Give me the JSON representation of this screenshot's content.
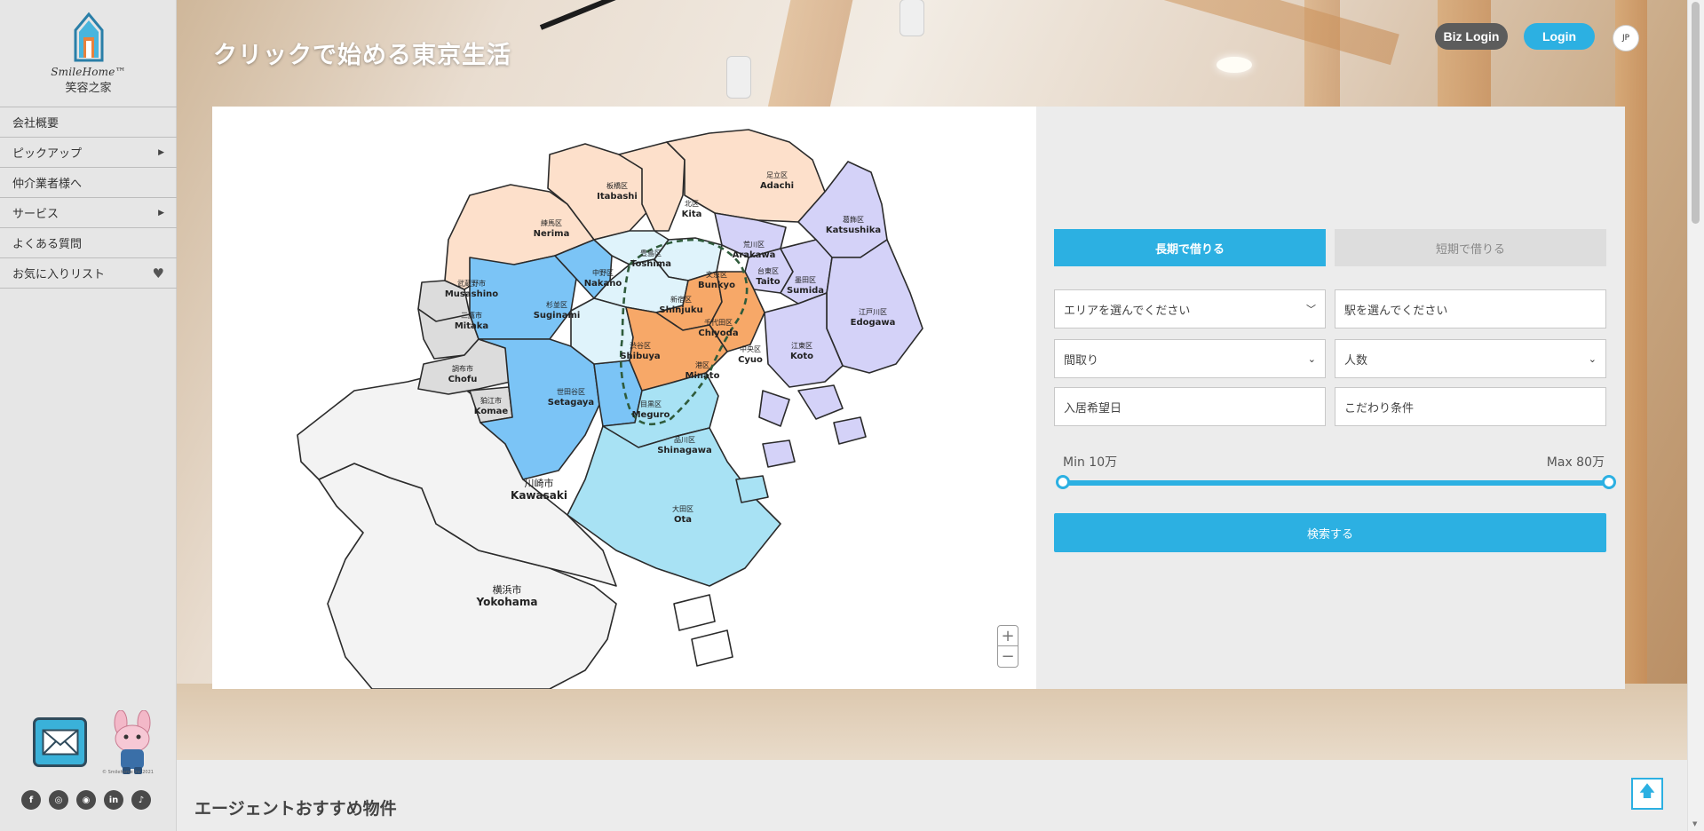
{
  "brand": {
    "name": "SmileHome™",
    "sub": "笑容之家"
  },
  "nav": [
    {
      "label": "会社概要",
      "has_submenu": false
    },
    {
      "label": "ピックアップ",
      "has_submenu": true
    },
    {
      "label": "仲介業者様へ",
      "has_submenu": false
    },
    {
      "label": "サービス",
      "has_submenu": true
    },
    {
      "label": "よくある質問",
      "has_submenu": false
    },
    {
      "label": "お気に入りリスト",
      "has_heart": true
    }
  ],
  "icons": {
    "submenu": "caret-right-icon",
    "favorite": "heart-icon",
    "mail": "mail-icon",
    "zoom_in": "plus-icon",
    "zoom_out": "minus-icon",
    "to_top": "arrow-up-icon"
  },
  "copyright": "© Smilehome Inc 2021",
  "socials": [
    {
      "name": "facebook-icon",
      "glyph": "f"
    },
    {
      "name": "instagram-icon",
      "glyph": "◎"
    },
    {
      "name": "line-icon",
      "glyph": "◉"
    },
    {
      "name": "linkedin-icon",
      "glyph": "in"
    },
    {
      "name": "tiktok-icon",
      "glyph": "♪"
    }
  ],
  "header": {
    "title": "クリックで始める東京生活",
    "biz_login": "Biz Login",
    "login": "Login",
    "lang": "JP"
  },
  "map": {
    "zoom_in": "+",
    "zoom_out": "−",
    "wards": [
      {
        "jp": "板橋区",
        "en": "Itabashi"
      },
      {
        "jp": "足立区",
        "en": "Adachi"
      },
      {
        "jp": "北区",
        "en": "Kita"
      },
      {
        "jp": "葛飾区",
        "en": "Katsushika"
      },
      {
        "jp": "練馬区",
        "en": "Nerima"
      },
      {
        "jp": "荒川区",
        "en": "Arakawa"
      },
      {
        "jp": "豊島区",
        "en": "Toshima"
      },
      {
        "jp": "中野区",
        "en": "Nakano"
      },
      {
        "jp": "文京区",
        "en": "Bunkyo"
      },
      {
        "jp": "台東区",
        "en": "Taito"
      },
      {
        "jp": "墨田区",
        "en": "Sumida"
      },
      {
        "jp": "武蔵野市",
        "en": "Musashino"
      },
      {
        "jp": "杉並区",
        "en": "Suginami"
      },
      {
        "jp": "新宿区",
        "en": "Shinjuku"
      },
      {
        "jp": "江戸川区",
        "en": "Edogawa"
      },
      {
        "jp": "三鷹市",
        "en": "Mitaka"
      },
      {
        "jp": "千代田区",
        "en": "Chiyoda"
      },
      {
        "jp": "渋谷区",
        "en": "Shibuya"
      },
      {
        "jp": "中央区",
        "en": "Cyuo"
      },
      {
        "jp": "江東区",
        "en": "Koto"
      },
      {
        "jp": "調布市",
        "en": "Chofu"
      },
      {
        "jp": "港区",
        "en": "Minato"
      },
      {
        "jp": "世田谷区",
        "en": "Setagaya"
      },
      {
        "jp": "狛江市",
        "en": "Komae"
      },
      {
        "jp": "目黒区",
        "en": "Meguro"
      },
      {
        "jp": "品川区",
        "en": "Shinagawa"
      },
      {
        "jp": "川崎市",
        "en": "Kawasaki"
      },
      {
        "jp": "大田区",
        "en": "Ota"
      },
      {
        "jp": "横浜市",
        "en": "Yokohama"
      }
    ]
  },
  "search": {
    "tab_long": "長期で借りる",
    "tab_short": "短期で借りる",
    "area_placeholder": "エリアを選んでください",
    "station_placeholder": "駅を選んでください",
    "layout_label": "間取り",
    "people_label": "人数",
    "move_in_placeholder": "入居希望日",
    "conditions_placeholder": "こだわり条件",
    "min_label": "Min 10万",
    "max_label": "Max 80万",
    "submit": "検索する"
  },
  "section": {
    "title": "エージェントおすすめ物件"
  }
}
